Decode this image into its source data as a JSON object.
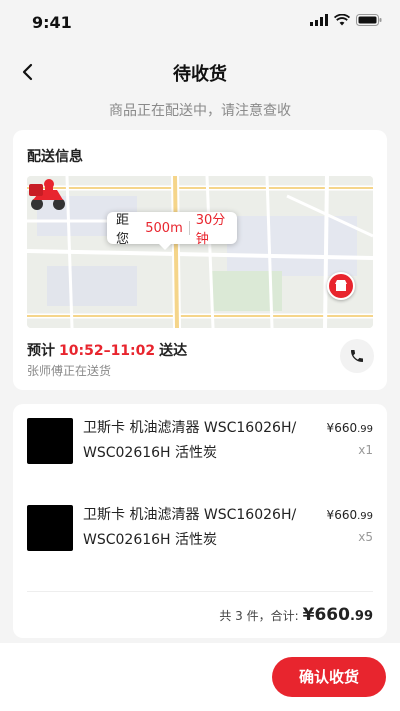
{
  "status_bar": {
    "time": "9:41"
  },
  "nav": {
    "title": "待收货",
    "subtitle": "商品正在配送中，请注意查收"
  },
  "delivery": {
    "section_title": "配送信息",
    "map": {
      "distance_prefix": "距您",
      "distance": "500m",
      "time": "30分钟"
    },
    "eta_prefix": "预计",
    "eta_time": "10:52–11:02",
    "eta_suffix": "送达",
    "courier_status": "张师傅正在送货"
  },
  "goods": {
    "items": [
      {
        "name": "卫斯卡 机油滤清器 WSC16026H/ WSC02616H 活性炭",
        "price_symbol": "¥",
        "price_int": "660",
        "price_dec": ".99",
        "qty": "x1"
      },
      {
        "name": "卫斯卡 机油滤清器 WSC16026H/ WSC02616H 活性炭",
        "price_symbol": "¥",
        "price_int": "660",
        "price_dec": ".99",
        "qty": "x5"
      }
    ],
    "summary": {
      "count_text": "共 3 件，合计:",
      "price_symbol": "¥",
      "price_int": "660",
      "price_dec": ".99"
    }
  },
  "footer": {
    "confirm_label": "确认收货"
  },
  "colors": {
    "accent": "#e8252e",
    "background": "#f4f4f4",
    "muted_text": "#8a8a8a"
  },
  "icons": {
    "back": "chevron-left-icon",
    "phone": "phone-icon",
    "rider": "delivery-rider-icon",
    "store": "store-pin-icon"
  }
}
